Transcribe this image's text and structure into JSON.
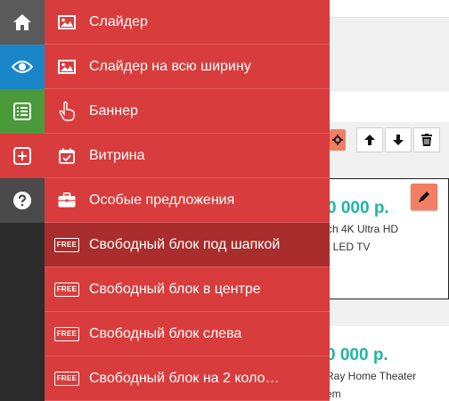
{
  "rail": {
    "items": [
      {
        "icon": "home-icon",
        "color": "#5a5a5a"
      },
      {
        "icon": "eye-icon",
        "color": "#1a86c9"
      },
      {
        "icon": "list-icon",
        "color": "#4a9a3b"
      },
      {
        "icon": "plus-square-icon",
        "color": "#d93c3c"
      },
      {
        "icon": "question-circle-icon",
        "color": "#4a4a4a"
      }
    ]
  },
  "menu": {
    "items": [
      {
        "label": "Слайдер",
        "icon": "image-icon",
        "active": false
      },
      {
        "label": "Слайдер на всю ширину",
        "icon": "image-icon",
        "active": false
      },
      {
        "label": "Баннер",
        "icon": "pointer-hand-icon",
        "active": false
      },
      {
        "label": "Витрина",
        "icon": "calendar-check-icon",
        "active": false
      },
      {
        "label": "Особые предложения",
        "icon": "briefcase-icon",
        "active": false
      },
      {
        "label": "Свободный блок под шапкой",
        "icon": "free-badge-icon",
        "badge": "FREE",
        "active": true
      },
      {
        "label": "Свободный блок в центре",
        "icon": "free-badge-icon",
        "badge": "FREE",
        "active": false
      },
      {
        "label": "Свободный блок слева",
        "icon": "free-badge-icon",
        "badge": "FREE",
        "active": false
      },
      {
        "label": "Свободный блок на 2 коло…",
        "icon": "free-badge-icon",
        "badge": "FREE",
        "active": false
      }
    ]
  },
  "background": {
    "product1": {
      "price": "0 000 р.",
      "name_line1": "ch 4K Ultra HD",
      "name_line2": "t LED TV"
    },
    "product2": {
      "price": "0 000 р.",
      "name_line1": "Ray Home Theater",
      "name_line2": "em"
    }
  },
  "colors": {
    "menu_bg": "#d93c3c",
    "menu_active": "#a92d2d",
    "accent_orange": "#f27e64",
    "price": "#1fb6a3"
  }
}
